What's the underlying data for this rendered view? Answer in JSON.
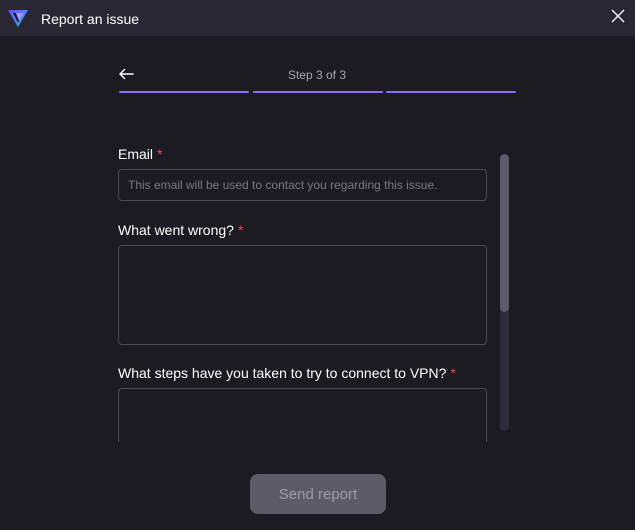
{
  "window": {
    "title": "Report an issue",
    "logo_icon": "proton-vpn-logo",
    "close_icon": "close-icon"
  },
  "wizard": {
    "back_icon": "arrow-left-icon",
    "step_label": "Step 3 of 3",
    "current_step": 3,
    "total_steps": 3,
    "accent_color": "#8a6ef9"
  },
  "form": {
    "email": {
      "label": "Email",
      "required_mark": "*",
      "value": "",
      "placeholder": "This email will be used to contact you regarding this issue."
    },
    "what_went_wrong": {
      "label": "What went wrong?",
      "required_mark": "*",
      "value": ""
    },
    "steps_taken": {
      "label": "What steps have you taken to try to connect to VPN?",
      "required_mark": "*",
      "value": ""
    }
  },
  "actions": {
    "send_label": "Send report",
    "send_enabled": false
  },
  "colors": {
    "background": "#1c1b22",
    "titlebar": "#292733",
    "required": "#f5455c",
    "button_disabled": "#5e5b69"
  }
}
